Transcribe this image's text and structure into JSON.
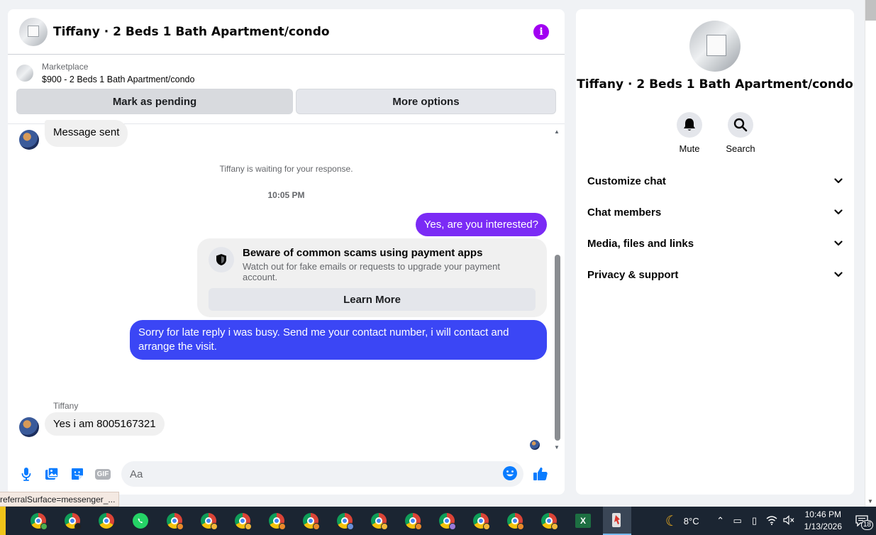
{
  "chat": {
    "title": "Tiffany · 2 Beds 1 Bath Apartment/condo",
    "info_icon": "i"
  },
  "marketplace": {
    "label": "Marketplace",
    "listing": "$900 - 2 Beds 1 Bath Apartment/condo",
    "pending_button": "Mark as pending",
    "more_button": "More options"
  },
  "messages": {
    "sent_notice": "Message sent",
    "waiting_note": "Tiffany is waiting for your response.",
    "timestamp": "10:05 PM",
    "out_1": "Yes, are you interested?",
    "scam_title": "Beware of common scams using payment apps",
    "scam_desc": "Watch out for fake emails or requests to upgrade your payment account.",
    "scam_button": "Learn More",
    "out_2": "Sorry for late reply i was busy. Send me your contact number, i will contact and arrange the visit.",
    "sender_name": "Tiffany",
    "in_reply": "Yes i am 8005167321"
  },
  "composer": {
    "placeholder": "Aa",
    "gif_label": "GIF"
  },
  "status_url": "referralSurface=messenger_...",
  "info_panel": {
    "title": "Tiffany · 2 Beds 1 Bath Apartment/condo",
    "mute_label": "Mute",
    "search_label": "Search",
    "sections": [
      "Customize chat",
      "Chat members",
      "Media, files and links",
      "Privacy & support"
    ]
  },
  "taskbar": {
    "temperature": "8°C",
    "time": "10:46 PM",
    "date": "1/13/2026",
    "notification_count": "18",
    "excel_letter": "X"
  },
  "colors": {
    "accent_purple": "#7b2bf5",
    "accent_blue": "#3b46f5",
    "info_purple": "#a100f2",
    "messenger_blue": "#0a7cff"
  }
}
